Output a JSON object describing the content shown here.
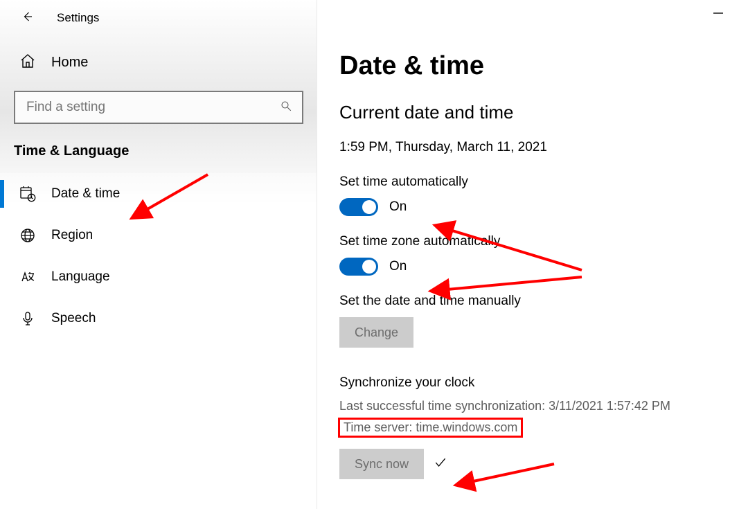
{
  "window": {
    "title": "Settings"
  },
  "sidebar": {
    "home_label": "Home",
    "search_placeholder": "Find a setting",
    "category_heading": "Time & Language",
    "items": [
      {
        "label": "Date & time",
        "icon": "calendar-clock-icon",
        "active": true
      },
      {
        "label": "Region",
        "icon": "globe-icon",
        "active": false
      },
      {
        "label": "Language",
        "icon": "language-icon",
        "active": false
      },
      {
        "label": "Speech",
        "icon": "microphone-icon",
        "active": false
      }
    ]
  },
  "main": {
    "page_title": "Date & time",
    "section_title": "Current date and time",
    "current_datetime": "1:59 PM, Thursday, March 11, 2021",
    "set_time_auto": {
      "label": "Set time automatically",
      "state_text": "On",
      "on": true
    },
    "set_tz_auto": {
      "label": "Set time zone automatically",
      "state_text": "On",
      "on": true
    },
    "set_manual": {
      "label": "Set the date and time manually",
      "button": "Change"
    },
    "sync": {
      "heading": "Synchronize your clock",
      "last_sync": "Last successful time synchronization: 3/11/2021 1:57:42 PM",
      "time_server": "Time server: time.windows.com",
      "button": "Sync now"
    }
  }
}
